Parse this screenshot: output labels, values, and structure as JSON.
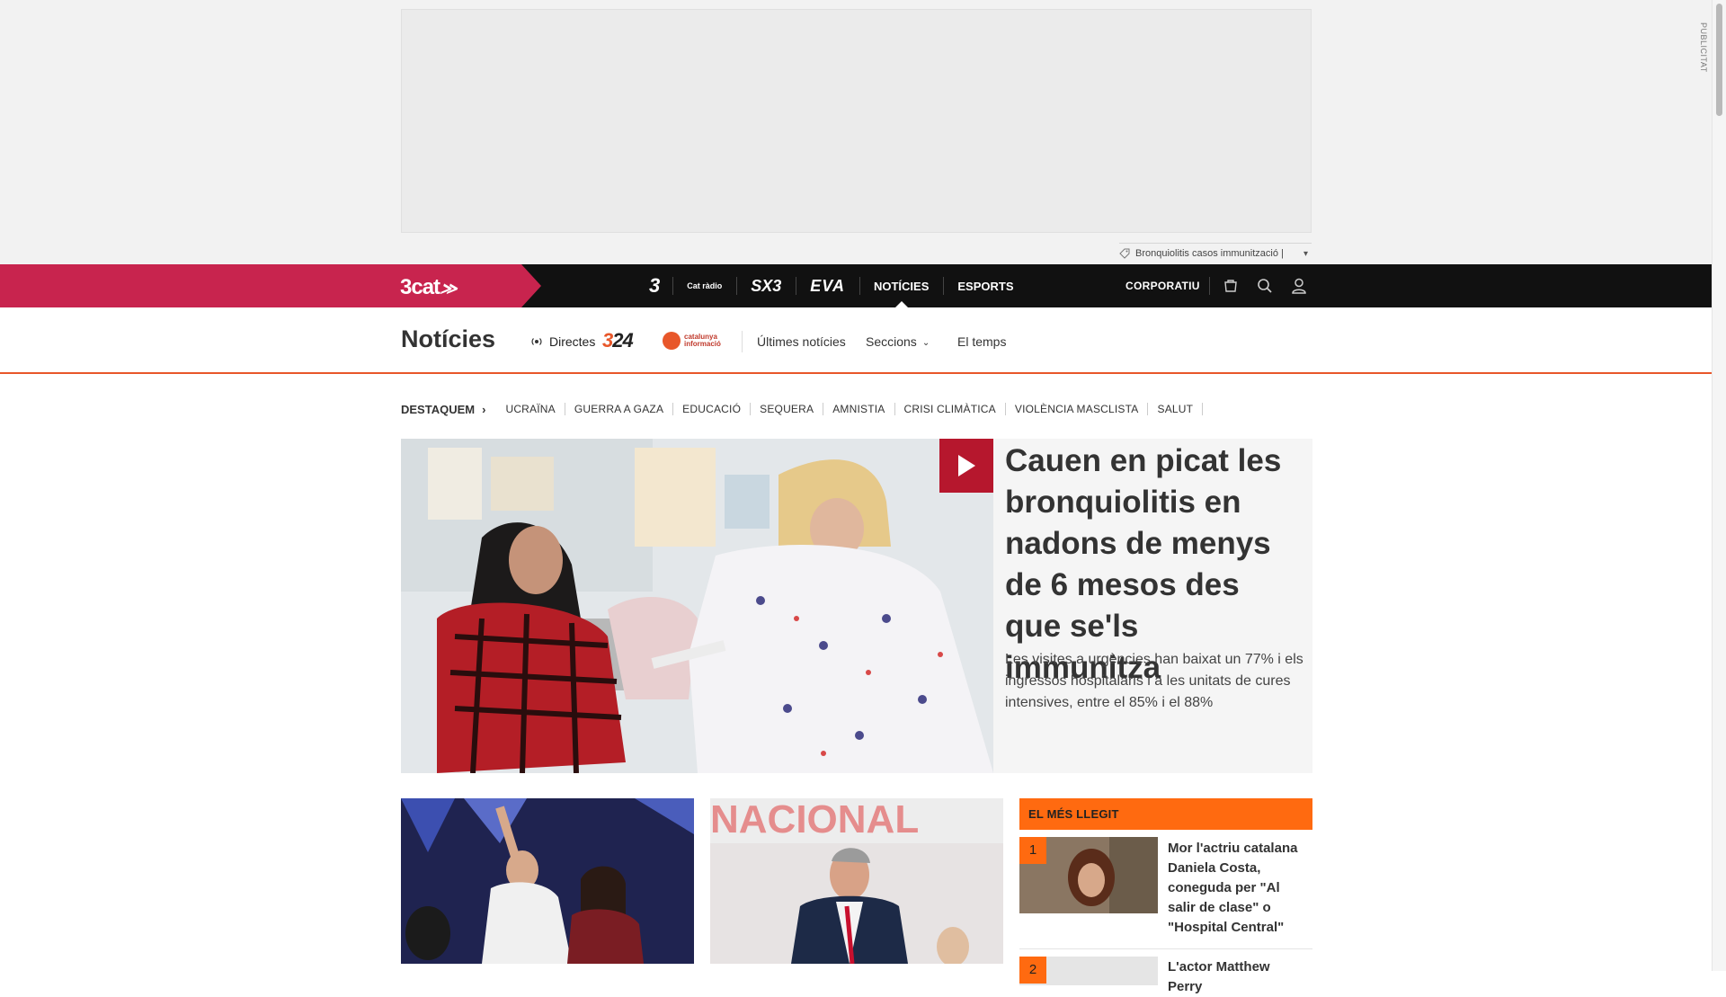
{
  "ad": {
    "label": "PUBLICITAT"
  },
  "ticker": {
    "text": "Bronquiolitis casos immunització |",
    "chevron": "▾"
  },
  "topbar": {
    "brand": "3cat",
    "channels": [
      {
        "label": "3",
        "kind": "tv3"
      },
      {
        "label": "Cat ràdio",
        "kind": "catradio"
      },
      {
        "label": "SX3",
        "kind": "sx3"
      },
      {
        "label": "EVA",
        "kind": "eva"
      },
      {
        "label": "NOTÍCIES",
        "kind": "text"
      },
      {
        "label": "ESPORTS",
        "kind": "text"
      }
    ],
    "corporatiu": "CORPORATIU"
  },
  "section": {
    "title": "Notícies",
    "directes": "Directes",
    "logo324": {
      "a": "3",
      "b": "24"
    },
    "logo_ci": {
      "line1": "catalunya",
      "line2": "informació"
    },
    "links": {
      "ultimes": "Últimes notícies",
      "seccions": "Seccions",
      "temps": "El temps"
    }
  },
  "tags": {
    "lead": "DESTAQUEM",
    "items": [
      "UCRAÏNA",
      "GUERRA A GAZA",
      "EDUCACIÓ",
      "SEQUERA",
      "AMNISTIA",
      "CRISI CLIMÀTICA",
      "VIOLÈNCIA MASCLISTA",
      "SALUT"
    ]
  },
  "hero": {
    "title": "Cauen en picat les bronquiolitis en nadons de menys de 6 mesos des que se'ls immunitza",
    "subtitle": "Les visites a urgències han baixat un 77% i els ingressos hospitalaris i a les unitats de cures intensives, entre el 85% i el 88%"
  },
  "cards": [
    {
      "image": "rally-celebration-photo"
    },
    {
      "image": "politician-nacional-photo",
      "backdrop_text": "NACIONAL"
    }
  ],
  "most_read": {
    "heading": "EL MÉS LLEGIT",
    "items": [
      {
        "rank": "1",
        "title": "Mor l'actriu catalana Daniela Costa, coneguda per \"Al salir de clase\" o \"Hospital Central\""
      },
      {
        "rank": "2",
        "title": "L'actor Matthew Perry"
      }
    ]
  },
  "colors": {
    "brand": "#c8244e",
    "accent": "#e8572a",
    "orange": "#ff6a10",
    "play": "#b6172d"
  }
}
